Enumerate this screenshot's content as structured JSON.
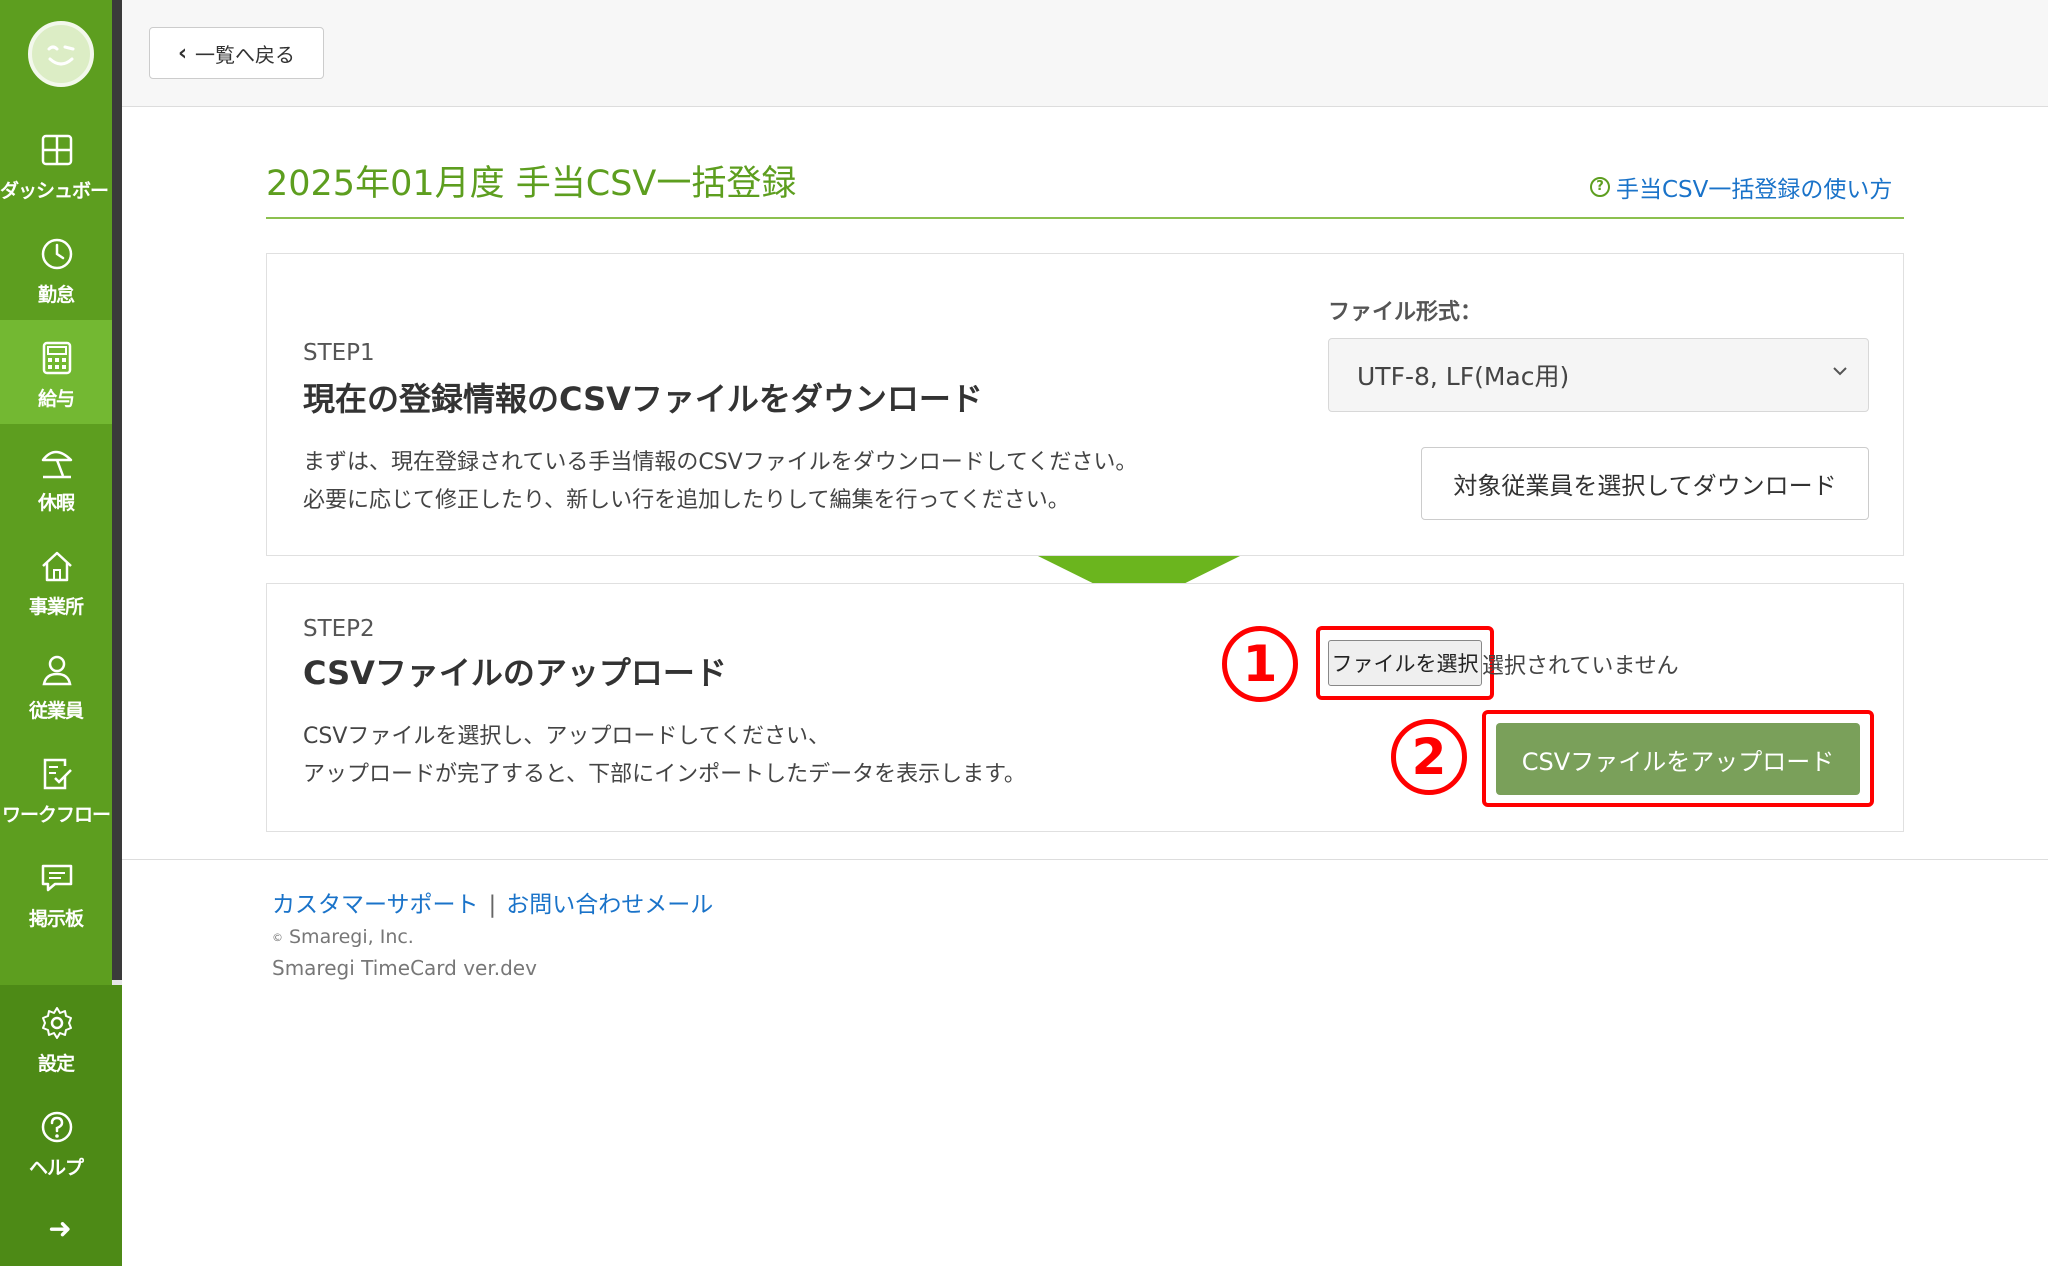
{
  "sidebar": {
    "items": [
      {
        "label": "ダッシュボード",
        "icon": "dashboard-icon"
      },
      {
        "label": "勤怠",
        "icon": "clock-icon"
      },
      {
        "label": "給与",
        "icon": "calculator-icon"
      },
      {
        "label": "休暇",
        "icon": "beach-umbrella-icon"
      },
      {
        "label": "事業所",
        "icon": "home-icon"
      },
      {
        "label": "従業員",
        "icon": "person-icon"
      },
      {
        "label": "ワークフロー",
        "icon": "checklist-icon"
      },
      {
        "label": "掲示板",
        "icon": "message-board-icon"
      }
    ],
    "bottom_items": [
      {
        "label": "設定",
        "icon": "gear-icon"
      },
      {
        "label": "ヘルプ",
        "icon": "question-circle-icon"
      }
    ],
    "expand_symbol": "➜"
  },
  "header": {
    "back_label": "一覧へ戻る",
    "back_symbol": "‹"
  },
  "page": {
    "title": "2025年01月度 手当CSV一括登録",
    "help_link": "手当CSV一括登録の使い方",
    "help_symbol": "?"
  },
  "step1": {
    "label": "STEP1",
    "title": "現在の登録情報のCSVファイルをダウンロード",
    "desc_line1": "まずは、現在登録されている手当情報のCSVファイルをダウンロードしてください。",
    "desc_line2": "必要に応じて修正したり、新しい行を追加したりして編集を行ってください。",
    "file_format_label": "ファイル形式：",
    "file_format_value": "UTF-8, LF(Mac用)",
    "download_button": "対象従業員を選択してダウンロード"
  },
  "step2": {
    "label": "STEP2",
    "title": "CSVファイルのアップロード",
    "desc_line1": "CSVファイルを選択し、アップロードしてください、",
    "desc_line2": "アップロードが完了すると、下部にインポートしたデータを表示します。",
    "choose_file_button": "ファイルを選択",
    "no_file_text": "選択されていません",
    "upload_button": "CSVファイルをアップロード",
    "marker1": "1",
    "marker2": "2"
  },
  "footer": {
    "support_link": "カスタマーサポート",
    "separator": "|",
    "contact_link": "お問い合わせメール",
    "copyright_symbol": "©",
    "copyright": "Smaregi, Inc.",
    "version": "Smaregi TimeCard ver.dev"
  },
  "colors": {
    "sidebar": "#5d9e1f",
    "active": "#73b832",
    "title": "#5d9e1f",
    "link": "#1a73c9",
    "upload_button": "#7aa05a",
    "annotation": "#ff0000"
  }
}
